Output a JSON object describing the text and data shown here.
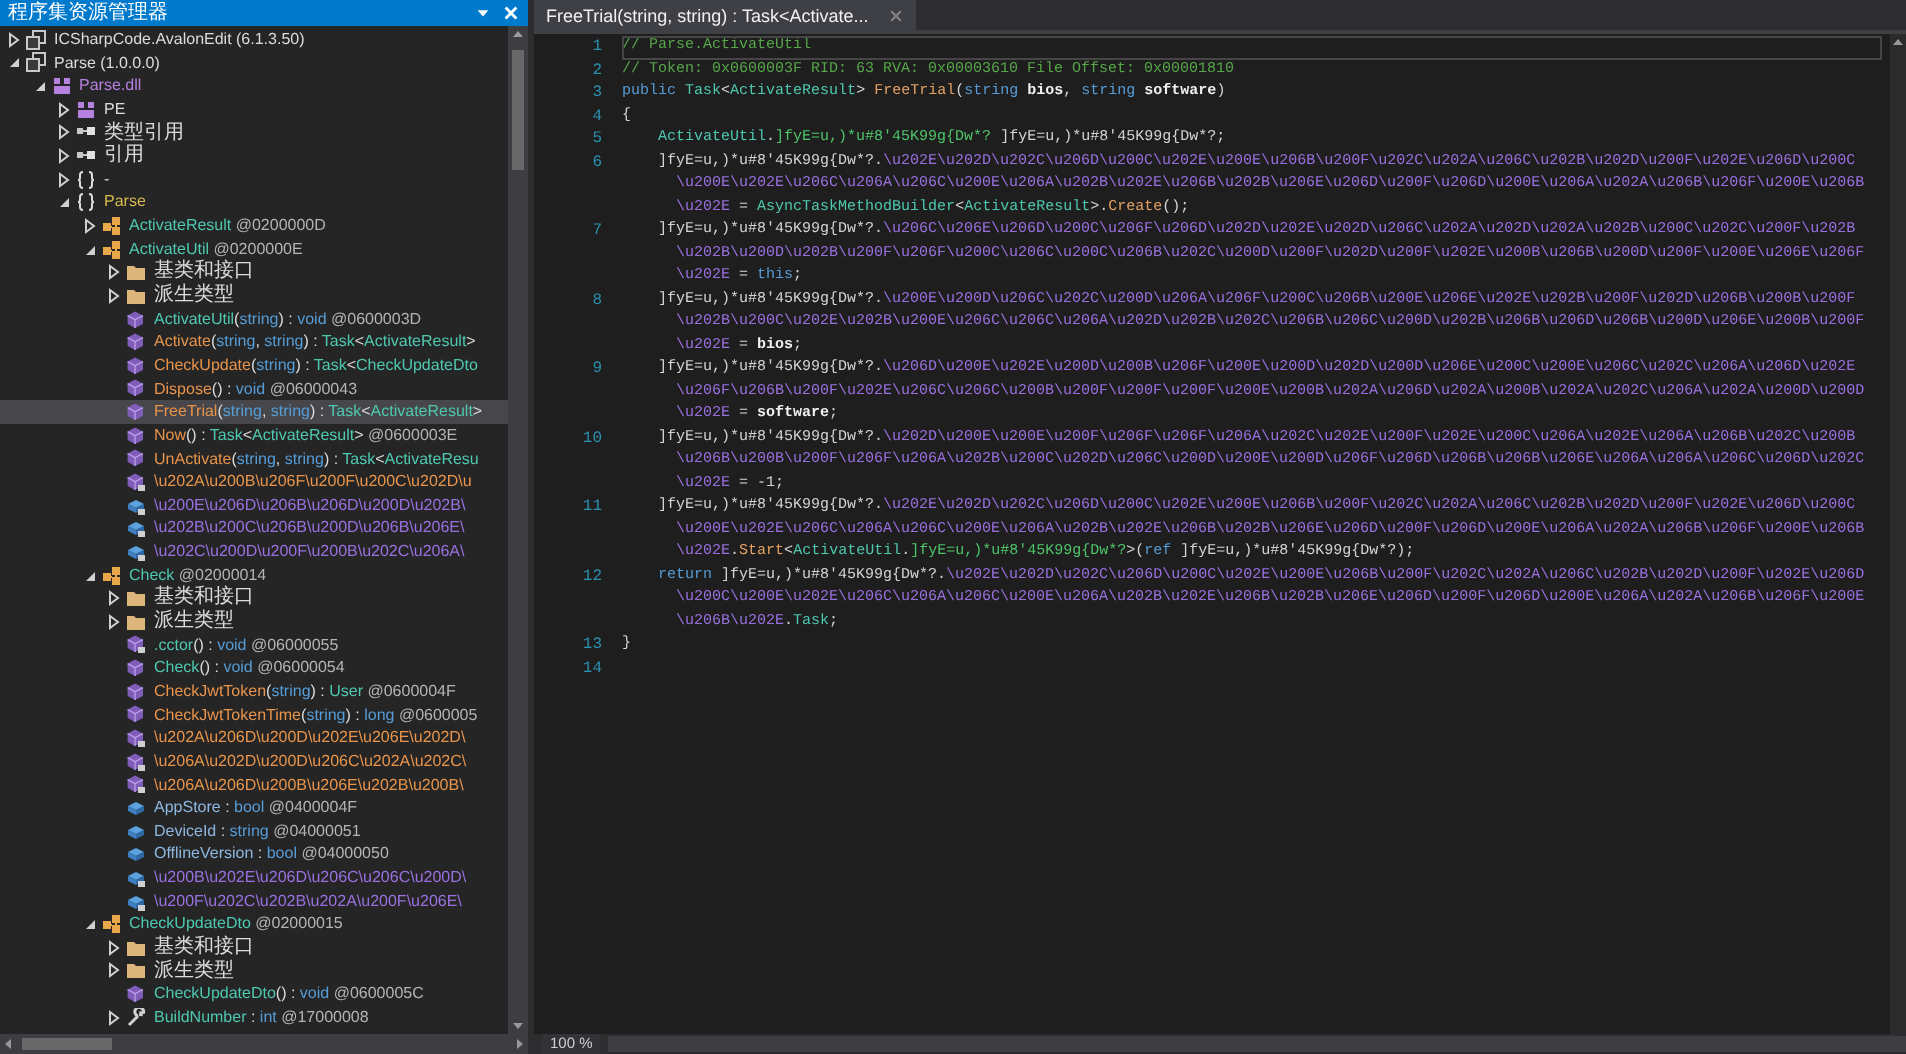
{
  "explorer": {
    "title": "程序集资源管理器",
    "tree": [
      {
        "kind": "assembly",
        "expanded": false,
        "selected": false,
        "parts": [
          {
            "text": "ICSharpCode.AvalonEdit (6.1.3.50)",
            "kind": "plain"
          }
        ]
      },
      {
        "kind": "assembly",
        "expanded": true,
        "selected": false,
        "parts": [
          {
            "text": "Parse (1.0.0.0)",
            "kind": "plain"
          }
        ],
        "children": [
          {
            "kind": "module",
            "expanded": true,
            "selected": false,
            "parts": [
              {
                "text": "Parse.dll",
                "kind": "module"
              }
            ],
            "children": [
              {
                "kind": "module",
                "expanded": false,
                "selected": false,
                "parts": [
                  {
                    "text": "PE",
                    "kind": "plain"
                  }
                ]
              },
              {
                "kind": "refs",
                "expanded": false,
                "selected": false,
                "parts": [
                  {
                    "text": "类型引用",
                    "kind": "plain"
                  }
                ]
              },
              {
                "kind": "refs",
                "expanded": false,
                "selected": false,
                "parts": [
                  {
                    "text": "引用",
                    "kind": "plain"
                  }
                ]
              },
              {
                "kind": "namespace",
                "expanded": false,
                "selected": false,
                "parts": [
                  {
                    "text": "-",
                    "kind": "plain"
                  }
                ]
              },
              {
                "kind": "namespace",
                "expanded": true,
                "selected": false,
                "parts": [
                  {
                    "text": "Parse",
                    "kind": "namespace"
                  }
                ],
                "children": [
                  {
                    "kind": "class",
                    "expanded": false,
                    "selected": false,
                    "parts": [
                      {
                        "text": "ActivateResult",
                        "kind": "type"
                      },
                      {
                        "text": " @0200000D",
                        "kind": "token"
                      }
                    ]
                  },
                  {
                    "kind": "class",
                    "expanded": true,
                    "selected": false,
                    "parts": [
                      {
                        "text": "ActivateUtil",
                        "kind": "type"
                      },
                      {
                        "text": " @0200000E",
                        "kind": "token"
                      }
                    ],
                    "children": [
                      {
                        "kind": "folder",
                        "expanded": false,
                        "selected": false,
                        "parts": [
                          {
                            "text": "基类和接口",
                            "kind": "plain"
                          }
                        ]
                      },
                      {
                        "kind": "folder",
                        "expanded": false,
                        "selected": false,
                        "parts": [
                          {
                            "text": "派生类型",
                            "kind": "plain"
                          }
                        ]
                      },
                      {
                        "kind": "method",
                        "selected": false,
                        "parts": [
                          {
                            "text": "ActivateUtil",
                            "kind": "type"
                          },
                          {
                            "text": "(",
                            "kind": "plain"
                          },
                          {
                            "text": "string",
                            "kind": "keyword"
                          },
                          {
                            "text": ") : ",
                            "kind": "plain"
                          },
                          {
                            "text": "void",
                            "kind": "keyword"
                          },
                          {
                            "text": " @0600003D",
                            "kind": "token"
                          }
                        ]
                      },
                      {
                        "kind": "method",
                        "selected": false,
                        "parts": [
                          {
                            "text": "Activate",
                            "kind": "name"
                          },
                          {
                            "text": "(",
                            "kind": "plain"
                          },
                          {
                            "text": "string",
                            "kind": "keyword"
                          },
                          {
                            "text": ", ",
                            "kind": "plain"
                          },
                          {
                            "text": "string",
                            "kind": "keyword"
                          },
                          {
                            "text": ") : ",
                            "kind": "plain"
                          },
                          {
                            "text": "Task",
                            "kind": "type"
                          },
                          {
                            "text": "<",
                            "kind": "plain"
                          },
                          {
                            "text": "ActivateResult",
                            "kind": "type"
                          },
                          {
                            "text": ">",
                            "kind": "plain"
                          }
                        ]
                      },
                      {
                        "kind": "method",
                        "selected": false,
                        "parts": [
                          {
                            "text": "CheckUpdate",
                            "kind": "name"
                          },
                          {
                            "text": "(",
                            "kind": "plain"
                          },
                          {
                            "text": "string",
                            "kind": "keyword"
                          },
                          {
                            "text": ") : ",
                            "kind": "plain"
                          },
                          {
                            "text": "Task",
                            "kind": "type"
                          },
                          {
                            "text": "<",
                            "kind": "plain"
                          },
                          {
                            "text": "CheckUpdateDto",
                            "kind": "type"
                          }
                        ]
                      },
                      {
                        "kind": "method",
                        "selected": false,
                        "parts": [
                          {
                            "text": "Dispose",
                            "kind": "name"
                          },
                          {
                            "text": "() : ",
                            "kind": "plain"
                          },
                          {
                            "text": "void",
                            "kind": "keyword"
                          },
                          {
                            "text": " @06000043",
                            "kind": "token"
                          }
                        ]
                      },
                      {
                        "kind": "method",
                        "selected": true,
                        "parts": [
                          {
                            "text": "FreeTrial",
                            "kind": "name"
                          },
                          {
                            "text": "(",
                            "kind": "plain"
                          },
                          {
                            "text": "string",
                            "kind": "keyword"
                          },
                          {
                            "text": ", ",
                            "kind": "plain"
                          },
                          {
                            "text": "string",
                            "kind": "keyword"
                          },
                          {
                            "text": ") : ",
                            "kind": "plain"
                          },
                          {
                            "text": "Task",
                            "kind": "type"
                          },
                          {
                            "text": "<",
                            "kind": "plain"
                          },
                          {
                            "text": "ActivateResult",
                            "kind": "type"
                          },
                          {
                            "text": ">",
                            "kind": "plain"
                          }
                        ]
                      },
                      {
                        "kind": "method",
                        "selected": false,
                        "parts": [
                          {
                            "text": "Now",
                            "kind": "name"
                          },
                          {
                            "text": "() : ",
                            "kind": "plain"
                          },
                          {
                            "text": "Task",
                            "kind": "type"
                          },
                          {
                            "text": "<",
                            "kind": "plain"
                          },
                          {
                            "text": "ActivateResult",
                            "kind": "type"
                          },
                          {
                            "text": ">",
                            "kind": "plain"
                          },
                          {
                            "text": " @0600003E",
                            "kind": "token"
                          }
                        ]
                      },
                      {
                        "kind": "method",
                        "selected": false,
                        "parts": [
                          {
                            "text": "UnActivate",
                            "kind": "name"
                          },
                          {
                            "text": "(",
                            "kind": "plain"
                          },
                          {
                            "text": "string",
                            "kind": "keyword"
                          },
                          {
                            "text": ", ",
                            "kind": "plain"
                          },
                          {
                            "text": "string",
                            "kind": "keyword"
                          },
                          {
                            "text": ") : ",
                            "kind": "plain"
                          },
                          {
                            "text": "Task",
                            "kind": "type"
                          },
                          {
                            "text": "<",
                            "kind": "plain"
                          },
                          {
                            "text": "ActivateResu",
                            "kind": "type"
                          }
                        ]
                      },
                      {
                        "kind": "method-private",
                        "selected": false,
                        "parts": [
                          {
                            "text": "\\u202A\\u200B\\u206F\\u200F\\u200C\\u202D\\u",
                            "kind": "name"
                          }
                        ]
                      },
                      {
                        "kind": "field-private",
                        "selected": false,
                        "parts": [
                          {
                            "text": "\\u200E\\u206D\\u206B\\u206D\\u200D\\u202B\\",
                            "kind": "obfuscated"
                          }
                        ]
                      },
                      {
                        "kind": "field-private",
                        "selected": false,
                        "parts": [
                          {
                            "text": "\\u202B\\u200C\\u206B\\u200D\\u206B\\u206E\\",
                            "kind": "obfuscated"
                          }
                        ]
                      },
                      {
                        "kind": "field-private",
                        "selected": false,
                        "parts": [
                          {
                            "text": "\\u202C\\u200D\\u200F\\u200B\\u202C\\u206A\\",
                            "kind": "obfuscated"
                          }
                        ]
                      }
                    ]
                  },
                  {
                    "kind": "class",
                    "expanded": true,
                    "selected": false,
                    "parts": [
                      {
                        "text": "Check",
                        "kind": "type"
                      },
                      {
                        "text": " @02000014",
                        "kind": "token"
                      }
                    ],
                    "children": [
                      {
                        "kind": "folder",
                        "expanded": false,
                        "selected": false,
                        "parts": [
                          {
                            "text": "基类和接口",
                            "kind": "plain"
                          }
                        ]
                      },
                      {
                        "kind": "folder",
                        "expanded": false,
                        "selected": false,
                        "parts": [
                          {
                            "text": "派生类型",
                            "kind": "plain"
                          }
                        ]
                      },
                      {
                        "kind": "method-private",
                        "selected": false,
                        "parts": [
                          {
                            "text": ".cctor",
                            "kind": "type"
                          },
                          {
                            "text": "() : ",
                            "kind": "plain"
                          },
                          {
                            "text": "void",
                            "kind": "keyword"
                          },
                          {
                            "text": " @06000055",
                            "kind": "token"
                          }
                        ]
                      },
                      {
                        "kind": "method",
                        "selected": false,
                        "parts": [
                          {
                            "text": "Check",
                            "kind": "type"
                          },
                          {
                            "text": "() : ",
                            "kind": "plain"
                          },
                          {
                            "text": "void",
                            "kind": "keyword"
                          },
                          {
                            "text": " @06000054",
                            "kind": "token"
                          }
                        ]
                      },
                      {
                        "kind": "method",
                        "selected": false,
                        "parts": [
                          {
                            "text": "CheckJwtToken",
                            "kind": "name"
                          },
                          {
                            "text": "(",
                            "kind": "plain"
                          },
                          {
                            "text": "string",
                            "kind": "keyword"
                          },
                          {
                            "text": ") : ",
                            "kind": "plain"
                          },
                          {
                            "text": "User",
                            "kind": "type"
                          },
                          {
                            "text": " @0600004F",
                            "kind": "token"
                          }
                        ]
                      },
                      {
                        "kind": "method",
                        "selected": false,
                        "parts": [
                          {
                            "text": "CheckJwtTokenTime",
                            "kind": "name"
                          },
                          {
                            "text": "(",
                            "kind": "plain"
                          },
                          {
                            "text": "string",
                            "kind": "keyword"
                          },
                          {
                            "text": ") : ",
                            "kind": "plain"
                          },
                          {
                            "text": "long",
                            "kind": "keyword"
                          },
                          {
                            "text": " @0600005",
                            "kind": "token"
                          }
                        ]
                      },
                      {
                        "kind": "method-private",
                        "selected": false,
                        "parts": [
                          {
                            "text": "\\u202A\\u206D\\u200D\\u202E\\u206E\\u202D\\",
                            "kind": "name"
                          }
                        ]
                      },
                      {
                        "kind": "method-private",
                        "selected": false,
                        "parts": [
                          {
                            "text": "\\u206A\\u202D\\u200D\\u206C\\u202A\\u202C\\",
                            "kind": "name"
                          }
                        ]
                      },
                      {
                        "kind": "method-private",
                        "selected": false,
                        "parts": [
                          {
                            "text": "\\u206A\\u206D\\u200B\\u206E\\u202B\\u200B\\",
                            "kind": "name"
                          }
                        ]
                      },
                      {
                        "kind": "field",
                        "selected": false,
                        "parts": [
                          {
                            "text": "AppStore",
                            "kind": "field"
                          },
                          {
                            "text": " : ",
                            "kind": "plain"
                          },
                          {
                            "text": "bool",
                            "kind": "keyword"
                          },
                          {
                            "text": " @0400004F",
                            "kind": "token"
                          }
                        ]
                      },
                      {
                        "kind": "field",
                        "selected": false,
                        "parts": [
                          {
                            "text": "DeviceId",
                            "kind": "field"
                          },
                          {
                            "text": " : ",
                            "kind": "plain"
                          },
                          {
                            "text": "string",
                            "kind": "keyword"
                          },
                          {
                            "text": " @04000051",
                            "kind": "token"
                          }
                        ]
                      },
                      {
                        "kind": "field",
                        "selected": false,
                        "parts": [
                          {
                            "text": "OfflineVersion",
                            "kind": "field"
                          },
                          {
                            "text": " : ",
                            "kind": "plain"
                          },
                          {
                            "text": "bool",
                            "kind": "keyword"
                          },
                          {
                            "text": " @04000050",
                            "kind": "token"
                          }
                        ]
                      },
                      {
                        "kind": "field-private",
                        "selected": false,
                        "parts": [
                          {
                            "text": "\\u200B\\u202E\\u206D\\u206C\\u206C\\u200D\\",
                            "kind": "obfuscated"
                          }
                        ]
                      },
                      {
                        "kind": "field-private",
                        "selected": false,
                        "parts": [
                          {
                            "text": "\\u200F\\u202C\\u202B\\u202A\\u200F\\u206E\\",
                            "kind": "obfuscated"
                          }
                        ]
                      }
                    ]
                  },
                  {
                    "kind": "class",
                    "expanded": true,
                    "selected": false,
                    "parts": [
                      {
                        "text": "CheckUpdateDto",
                        "kind": "type"
                      },
                      {
                        "text": " @02000015",
                        "kind": "token"
                      }
                    ],
                    "children": [
                      {
                        "kind": "folder",
                        "expanded": false,
                        "selected": false,
                        "parts": [
                          {
                            "text": "基类和接口",
                            "kind": "plain"
                          }
                        ]
                      },
                      {
                        "kind": "folder",
                        "expanded": false,
                        "selected": false,
                        "parts": [
                          {
                            "text": "派生类型",
                            "kind": "plain"
                          }
                        ]
                      },
                      {
                        "kind": "method",
                        "selected": false,
                        "parts": [
                          {
                            "text": "CheckUpdateDto",
                            "kind": "type"
                          },
                          {
                            "text": "() : ",
                            "kind": "plain"
                          },
                          {
                            "text": "void",
                            "kind": "keyword"
                          },
                          {
                            "text": " @0600005C",
                            "kind": "token"
                          }
                        ]
                      },
                      {
                        "kind": "property",
                        "expanded": false,
                        "selected": false,
                        "parts": [
                          {
                            "text": "BuildNumber",
                            "kind": "type"
                          },
                          {
                            "text": " : ",
                            "kind": "plain"
                          },
                          {
                            "text": "int",
                            "kind": "keyword"
                          },
                          {
                            "text": " @17000008",
                            "kind": "token"
                          }
                        ]
                      }
                    ]
                  }
                ]
              }
            ]
          }
        ]
      }
    ]
  },
  "editor": {
    "tab": {
      "label": "FreeTrial(string, string) : Task<Activate...",
      "selected": true
    },
    "lines": [
      {
        "number": "1",
        "kind": "top",
        "current": true,
        "parts": [
          {
            "text": "// Parse.ActivateUtil",
            "kind": "comment"
          }
        ]
      },
      {
        "number": "2",
        "kind": "top",
        "parts": [
          {
            "text": "// Token: 0x0600003F RID: 63 RVA: 0x00003610 File Offset: 0x00001810",
            "kind": "comment"
          }
        ]
      },
      {
        "number": "3",
        "kind": "top",
        "parts": [
          {
            "text": "public",
            "kind": "keyword"
          },
          {
            "text": " Task",
            "kind": "type"
          },
          {
            "text": "<",
            "kind": "plain"
          },
          {
            "text": "ActivateResult",
            "kind": "type"
          },
          {
            "text": "> ",
            "kind": "plain"
          },
          {
            "text": "FreeTrial",
            "kind": "method"
          },
          {
            "text": "(",
            "kind": "plain"
          },
          {
            "text": "string",
            "kind": "keyword"
          },
          {
            "text": " bios",
            "kind": "param"
          },
          {
            "text": ", ",
            "kind": "plain"
          },
          {
            "text": "string",
            "kind": "keyword"
          },
          {
            "text": " software",
            "kind": "param"
          },
          {
            "text": ")",
            "kind": "plain"
          }
        ]
      },
      {
        "number": "4",
        "kind": "top",
        "parts": [
          {
            "text": "{",
            "kind": "plain"
          }
        ]
      },
      {
        "number": "5",
        "kind": "statement",
        "parts": [
          {
            "text": "ActivateUtil",
            "kind": "type"
          },
          {
            "text": ".",
            "kind": "plain"
          },
          {
            "text": "]fyE=u,)*u#8'45K99g{Dw*?",
            "kind": "field"
          },
          {
            "text": " ]fyE=u,)*u#8'45K99g{Dw*?;",
            "kind": "plain"
          }
        ]
      },
      {
        "number": "6",
        "kind": "statement",
        "parts": [
          {
            "text": "]fyE=u,)*u#8'45K99g{Dw*?.",
            "kind": "plain"
          },
          {
            "text": "\\u202E\\u202D\\u202C\\u206D\\u200C\\u202E\\u200E\\u206B\\u200F\\u202C\\u202A\\u206C\\u202B\\u202D\\u200F\\u202E\\u206D\\u200C",
            "kind": "obfuscated"
          }
        ]
      },
      {
        "kind": "continuation",
        "parts": [
          {
            "text": "\\u200E\\u202E\\u206C\\u206A\\u206C\\u200E\\u206A\\u202B\\u202E\\u206B\\u202B\\u206E\\u206D\\u200F\\u206D\\u200E\\u206A\\u202A\\u206B\\u206F\\u200E\\u206B",
            "kind": "obfuscated"
          }
        ]
      },
      {
        "kind": "continuation",
        "parts": [
          {
            "text": "\\u202E",
            "kind": "obfuscated"
          },
          {
            "text": " = ",
            "kind": "plain"
          },
          {
            "text": "AsyncTaskMethodBuilder",
            "kind": "type"
          },
          {
            "text": "<",
            "kind": "plain"
          },
          {
            "text": "ActivateResult",
            "kind": "type"
          },
          {
            "text": ">.",
            "kind": "plain"
          },
          {
            "text": "Create",
            "kind": "method"
          },
          {
            "text": "();",
            "kind": "plain"
          }
        ]
      },
      {
        "number": "7",
        "kind": "statement",
        "parts": [
          {
            "text": "]fyE=u,)*u#8'45K99g{Dw*?.",
            "kind": "plain"
          },
          {
            "text": "\\u206C\\u206E\\u206D\\u200C\\u206F\\u206D\\u202D\\u202E\\u202D\\u206C\\u202A\\u202D\\u202A\\u202B\\u200C\\u202C\\u200F\\u202B",
            "kind": "obfuscated"
          }
        ]
      },
      {
        "kind": "continuation",
        "parts": [
          {
            "text": "\\u202B\\u200D\\u202B\\u200F\\u206F\\u200C\\u206C\\u200C\\u206B\\u202C\\u200D\\u200F\\u202D\\u200F\\u202E\\u200B\\u206B\\u200D\\u200F\\u200E\\u206E\\u206F",
            "kind": "obfuscated"
          }
        ]
      },
      {
        "kind": "continuation",
        "parts": [
          {
            "text": "\\u202E",
            "kind": "obfuscated"
          },
          {
            "text": " = ",
            "kind": "plain"
          },
          {
            "text": "this",
            "kind": "keyword"
          },
          {
            "text": ";",
            "kind": "plain"
          }
        ]
      },
      {
        "number": "8",
        "kind": "statement",
        "parts": [
          {
            "text": "]fyE=u,)*u#8'45K99g{Dw*?.",
            "kind": "plain"
          },
          {
            "text": "\\u200E\\u200D\\u206C\\u202C\\u200D\\u206A\\u206F\\u200C\\u206B\\u200E\\u206E\\u202E\\u202B\\u200F\\u202D\\u206B\\u200B\\u200F",
            "kind": "obfuscated"
          }
        ]
      },
      {
        "kind": "continuation",
        "parts": [
          {
            "text": "\\u202B\\u200C\\u202E\\u202B\\u200E\\u206C\\u206C\\u206A\\u202D\\u202B\\u202C\\u206B\\u206C\\u200D\\u202B\\u206B\\u206D\\u206B\\u200D\\u206E\\u200B\\u200F",
            "kind": "obfuscated"
          }
        ]
      },
      {
        "kind": "continuation",
        "parts": [
          {
            "text": "\\u202E",
            "kind": "obfuscated"
          },
          {
            "text": " = ",
            "kind": "plain"
          },
          {
            "text": "bios",
            "kind": "param"
          },
          {
            "text": ";",
            "kind": "plain"
          }
        ]
      },
      {
        "number": "9",
        "kind": "statement",
        "parts": [
          {
            "text": "]fyE=u,)*u#8'45K99g{Dw*?.",
            "kind": "plain"
          },
          {
            "text": "\\u206D\\u200E\\u202E\\u200D\\u200B\\u206F\\u200E\\u200D\\u202D\\u200D\\u206E\\u200C\\u200E\\u206C\\u202C\\u206A\\u206D\\u202E",
            "kind": "obfuscated"
          }
        ]
      },
      {
        "kind": "continuation",
        "parts": [
          {
            "text": "\\u206F\\u206B\\u200F\\u202E\\u206C\\u206C\\u200B\\u200F\\u200F\\u200F\\u200E\\u200B\\u202A\\u206D\\u202A\\u200B\\u202A\\u202C\\u206A\\u202A\\u200D\\u200D",
            "kind": "obfuscated"
          }
        ]
      },
      {
        "kind": "continuation",
        "parts": [
          {
            "text": "\\u202E",
            "kind": "obfuscated"
          },
          {
            "text": " = ",
            "kind": "plain"
          },
          {
            "text": "software",
            "kind": "param"
          },
          {
            "text": ";",
            "kind": "plain"
          }
        ]
      },
      {
        "number": "10",
        "kind": "statement",
        "parts": [
          {
            "text": "]fyE=u,)*u#8'45K99g{Dw*?.",
            "kind": "plain"
          },
          {
            "text": "\\u202D\\u200E\\u200E\\u200F\\u206F\\u206F\\u206A\\u202C\\u202E\\u200F\\u202E\\u200C\\u206A\\u202E\\u206A\\u206B\\u202C\\u200B",
            "kind": "obfuscated"
          }
        ]
      },
      {
        "kind": "continuation",
        "parts": [
          {
            "text": "\\u206B\\u200B\\u200F\\u206F\\u206A\\u202B\\u200C\\u202D\\u206C\\u200D\\u200E\\u200D\\u206F\\u206D\\u206B\\u206B\\u206E\\u206A\\u206A\\u206C\\u206D\\u202C",
            "kind": "obfuscated"
          }
        ]
      },
      {
        "kind": "continuation",
        "parts": [
          {
            "text": "\\u202E",
            "kind": "obfuscated"
          },
          {
            "text": " = -1;",
            "kind": "plain"
          }
        ]
      },
      {
        "number": "11",
        "kind": "statement",
        "parts": [
          {
            "text": "]fyE=u,)*u#8'45K99g{Dw*?.",
            "kind": "plain"
          },
          {
            "text": "\\u202E\\u202D\\u202C\\u206D\\u200C\\u202E\\u200E\\u206B\\u200F\\u202C\\u202A\\u206C\\u202B\\u202D\\u200F\\u202E\\u206D\\u200C",
            "kind": "obfuscated"
          }
        ]
      },
      {
        "kind": "continuation",
        "parts": [
          {
            "text": "\\u200E\\u202E\\u206C\\u206A\\u206C\\u200E\\u206A\\u202B\\u202E\\u206B\\u202B\\u206E\\u206D\\u200F\\u206D\\u200E\\u206A\\u202A\\u206B\\u206F\\u200E\\u206B",
            "kind": "obfuscated"
          }
        ]
      },
      {
        "kind": "continuation",
        "parts": [
          {
            "text": "\\u202E",
            "kind": "obfuscated"
          },
          {
            "text": ".",
            "kind": "plain"
          },
          {
            "text": "Start",
            "kind": "method"
          },
          {
            "text": "<",
            "kind": "plain"
          },
          {
            "text": "ActivateUtil",
            "kind": "type"
          },
          {
            "text": ".",
            "kind": "plain"
          },
          {
            "text": "]fyE=u,)*u#8'45K99g{Dw*?",
            "kind": "field"
          },
          {
            "text": ">(",
            "kind": "plain"
          },
          {
            "text": "ref",
            "kind": "keyword"
          },
          {
            "text": " ]fyE=u,)*u#8'45K99g{Dw*?);",
            "kind": "plain"
          }
        ]
      },
      {
        "number": "12",
        "kind": "statement",
        "parts": [
          {
            "text": "return",
            "kind": "keyword"
          },
          {
            "text": " ]fyE=u,)*u#8'45K99g{Dw*?.",
            "kind": "plain"
          },
          {
            "text": "\\u202E\\u202D\\u202C\\u206D\\u200C\\u202E\\u200E\\u206B\\u200F\\u202C\\u202A\\u206C\\u202B\\u202D\\u200F\\u202E\\u206D",
            "kind": "obfuscated"
          }
        ]
      },
      {
        "kind": "continuation",
        "parts": [
          {
            "text": "\\u200C\\u200E\\u202E\\u206C\\u206A\\u206C\\u200E\\u206A\\u202B\\u202E\\u206B\\u202B\\u206E\\u206D\\u200F\\u206D\\u200E\\u206A\\u202A\\u206B\\u206F\\u200E",
            "kind": "obfuscated"
          }
        ]
      },
      {
        "kind": "continuation",
        "parts": [
          {
            "text": "\\u206B\\u202E",
            "kind": "obfuscated"
          },
          {
            "text": ".",
            "kind": "plain"
          },
          {
            "text": "Task",
            "kind": "type"
          },
          {
            "text": ";",
            "kind": "plain"
          }
        ]
      },
      {
        "number": "13",
        "kind": "top",
        "parts": [
          {
            "text": "}",
            "kind": "plain"
          }
        ]
      },
      {
        "number": "14"
      }
    ],
    "zoom": "100 %"
  }
}
